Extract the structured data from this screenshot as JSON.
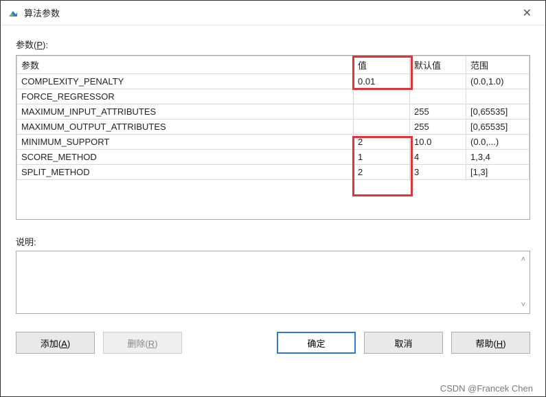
{
  "window": {
    "title": "算法参数"
  },
  "labels": {
    "params": "参数(P):",
    "desc": "说明:"
  },
  "headers": {
    "param": "参数",
    "value": "值",
    "default": "默认值",
    "range": "范围"
  },
  "rows": [
    {
      "param": "COMPLEXITY_PENALTY",
      "value": "0.01",
      "default": "",
      "range": "(0.0,1.0)"
    },
    {
      "param": "FORCE_REGRESSOR",
      "value": "",
      "default": "",
      "range": ""
    },
    {
      "param": "MAXIMUM_INPUT_ATTRIBUTES",
      "value": "",
      "default": "255",
      "range": "[0,65535]"
    },
    {
      "param": "MAXIMUM_OUTPUT_ATTRIBUTES",
      "value": "",
      "default": "255",
      "range": "[0,65535]"
    },
    {
      "param": "MINIMUM_SUPPORT",
      "value": "2",
      "default": "10.0",
      "range": "(0.0,...)"
    },
    {
      "param": "SCORE_METHOD",
      "value": "1",
      "default": "4",
      "range": "1,3,4"
    },
    {
      "param": "SPLIT_METHOD",
      "value": "2",
      "default": "3",
      "range": "[1,3]"
    }
  ],
  "buttons": {
    "add": "添加(A)",
    "remove": "删除(R)",
    "ok": "确定",
    "cancel": "取消",
    "help": "帮助(H)"
  },
  "watermark": "CSDN @Francek Chen"
}
